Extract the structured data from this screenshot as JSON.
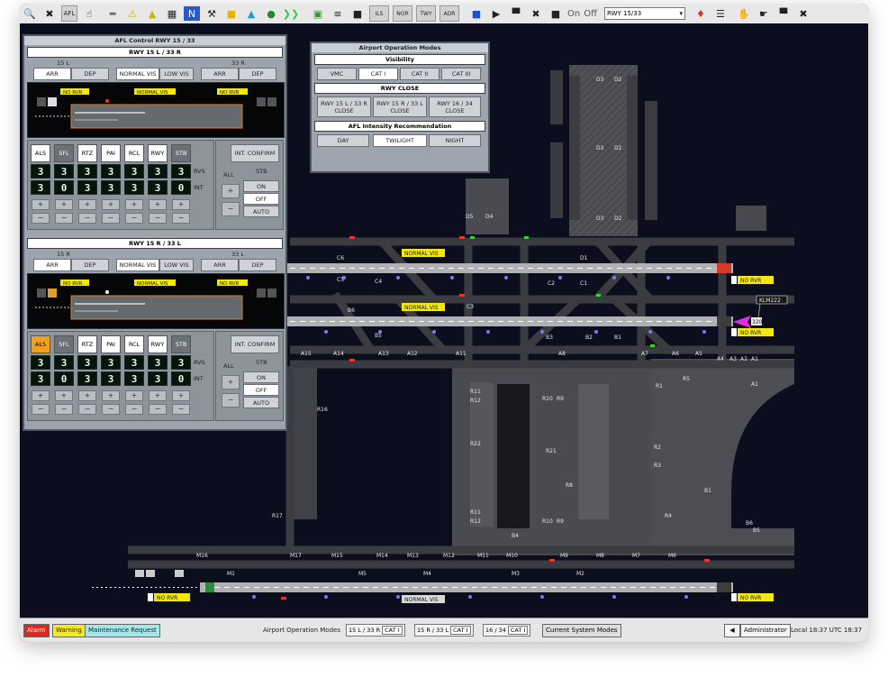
{
  "toolbar": {
    "afl_label": "AFL",
    "mini_labels": [
      "ILS",
      "NOR",
      "TWY",
      "ADR"
    ],
    "on_label": "On",
    "off_label": "Off",
    "rwy_select": "RWY 15/33"
  },
  "afl_panel": {
    "title": "AFL Control RWY 15 / 33",
    "sections": [
      {
        "header": "RWY 15 L / 33 R",
        "left_end": "15 L",
        "right_end": "33 R",
        "arr": "ARR",
        "dep": "DEP",
        "normal_vis": "NORMAL VIS",
        "low_vis": "LOW VIS",
        "diagram": {
          "left_tag": "NO RVR",
          "center_tag": "NORMAL VIS",
          "right_tag": "NO RVR"
        },
        "columns": [
          "ALS",
          "SFL",
          "RTZ",
          "PAI",
          "RCL",
          "RWY",
          "STB"
        ],
        "rvs_values": [
          "3",
          "3",
          "3",
          "3",
          "3",
          "3",
          "3"
        ],
        "int_values": [
          "3",
          "0",
          "3",
          "3",
          "3",
          "3",
          "0"
        ],
        "rvs_label": "RVS",
        "int_label": "INT",
        "confirm": "INT. CONFIRM",
        "all": "ALL",
        "stb": "STB",
        "on": "ON",
        "off": "OFF",
        "auto": "AUTO",
        "highlighted_col": -1
      },
      {
        "header": "RWY 15 R / 33 L",
        "left_end": "15 R",
        "right_end": "33 L",
        "arr": "ARR",
        "dep": "DEP",
        "normal_vis": "NORMAL VIS",
        "low_vis": "LOW VIS",
        "diagram": {
          "left_tag": "NO RVR",
          "center_tag": "NORMAL VIS",
          "right_tag": "NO RVR"
        },
        "columns": [
          "ALS",
          "SFL",
          "RTZ",
          "PAI",
          "RCL",
          "RWY",
          "STB"
        ],
        "rvs_values": [
          "3",
          "3",
          "3",
          "3",
          "3",
          "3",
          "3"
        ],
        "int_values": [
          "3",
          "0",
          "3",
          "3",
          "3",
          "3",
          "0"
        ],
        "rvs_label": "RVS",
        "int_label": "INT",
        "confirm": "INT. CONFIRM",
        "all": "ALL",
        "stb": "STB",
        "on": "ON",
        "off": "OFF",
        "auto": "AUTO",
        "highlighted_col": 0
      }
    ]
  },
  "modes_panel": {
    "title": "Airport Operation Modes",
    "visibility_header": "Visibility",
    "visibility": [
      "VMC",
      "CAT I",
      "CAT II",
      "CAT III"
    ],
    "rwy_close_header": "RWY CLOSE",
    "rwy_close": [
      "RWY 15 L / 33 R CLOSE",
      "RWY 15 R / 33 L CLOSE",
      "RWY 16 / 34 CLOSE"
    ],
    "intensity_header": "AFL Intensity Recommendation",
    "intensity": [
      "DAY",
      "TWILIGHT",
      "NIGHT"
    ]
  },
  "map": {
    "labels": [
      "D3",
      "D2",
      "D3",
      "D2",
      "D3",
      "D2",
      "D5",
      "D4",
      "D1",
      "C6",
      "C5",
      "C4",
      "C3",
      "C2",
      "C1",
      "B6",
      "B5",
      "B3",
      "B2",
      "B1",
      "A15",
      "A14",
      "A13",
      "A12",
      "A11",
      "A8",
      "A7",
      "A6",
      "A5",
      "A4",
      "A3",
      "A2",
      "A1",
      "R16",
      "R11",
      "R12",
      "R10",
      "R9",
      "R21",
      "R22",
      "R8",
      "R11",
      "R12",
      "R10",
      "R9",
      "R5",
      "R4",
      "R3",
      "R2",
      "R1",
      "R17",
      "M16",
      "M17",
      "M15",
      "M14",
      "M13",
      "M12",
      "M11",
      "M10",
      "M9",
      "M8",
      "M7",
      "M6",
      "M5",
      "M4",
      "M3",
      "M2",
      "M1",
      "B4",
      "B6",
      "B5",
      "B1",
      "A1"
    ],
    "normal_vis_tags": [
      "NORMAL VIS",
      "NORMAL VIS",
      "NORMAL VIS"
    ],
    "rvr_tags": [
      "NO RVR",
      "NO RVR",
      "NO RVR",
      "NO RVR"
    ],
    "aircraft_callsign": "KLM222",
    "aircraft_sub": "320"
  },
  "status": {
    "alarm": "Alarm",
    "warning": "Warning",
    "maintenance": "Maintenance Request",
    "modes_label": "Airport Operation Modes",
    "modes": [
      {
        "rwy": "15 L / 33 R",
        "cat": "CAT I"
      },
      {
        "rwy": "15 R / 33 L",
        "cat": "CAT I"
      },
      {
        "rwy": "16 / 34",
        "cat": "CAT I"
      }
    ],
    "current_modes": "Current System Modes",
    "user": "Administrator",
    "time": "Local 18:37 UTC 18:37"
  },
  "colors": {
    "alarm": "#e3261b",
    "warning": "#f3ec19",
    "maintenance": "#9fe8ec",
    "tag": "#f3e80e"
  }
}
